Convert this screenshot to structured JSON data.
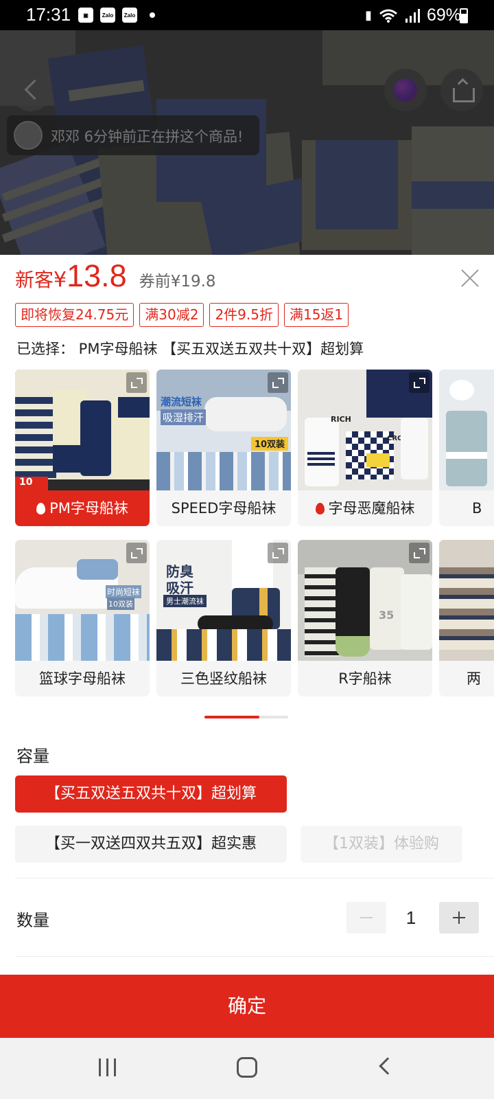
{
  "status_bar": {
    "time": "17:31",
    "notif_icons": [
      "image-icon",
      "zalo-icon",
      "zalo-icon"
    ],
    "zalo_label": "Zalo",
    "battery": "69%"
  },
  "hero": {
    "toast_text": "邓邓 6分钟前正在拼这个商品!"
  },
  "price": {
    "prefix": "新客",
    "currency": "¥",
    "value": "13.8",
    "original": "券前¥19.8",
    "accent_color": "#e0271c"
  },
  "tags": [
    "即将恢复24.75元",
    "满30减2",
    "2件9.5折",
    "满15返1"
  ],
  "selected_text": "已选择： PM字母船袜 【买五双送五双共十双】超划算",
  "styles": [
    {
      "label": "PM字母船袜",
      "hot": true
    },
    {
      "label": "SPEED字母船袜",
      "hot": false
    },
    {
      "label": "字母恶魔船袜",
      "hot": true
    },
    {
      "label": "B",
      "hot": false
    },
    {
      "label": "篮球字母船袜",
      "hot": false
    },
    {
      "label": "三色竖纹船袜",
      "hot": false
    },
    {
      "label": "R字船袜",
      "hot": false
    },
    {
      "label": "两",
      "hot": false
    }
  ],
  "style_image_text": {
    "card2_top": "潮流短袜",
    "card2_sub": "吸湿排汗",
    "card2_badge": "10双装",
    "card3_a": "RICH",
    "card3_b": "CROWN",
    "card5_a": "时尚短袜",
    "card5_b": "10双装",
    "card6_a": "防臭",
    "card6_b": "吸汗",
    "card6_c": "男士潮流袜",
    "card7_num": "35",
    "card1_badge": "10"
  },
  "capacity": {
    "title": "容量",
    "options": [
      {
        "label": "【买五双送五双共十双】超划算",
        "state": "selected"
      },
      {
        "label": "【买一双送四双共五双】超实惠",
        "state": "normal"
      },
      {
        "label": "【1双装】体验购",
        "state": "disabled"
      }
    ]
  },
  "quantity": {
    "title": "数量",
    "value": "1"
  },
  "confirm_label": "确定"
}
